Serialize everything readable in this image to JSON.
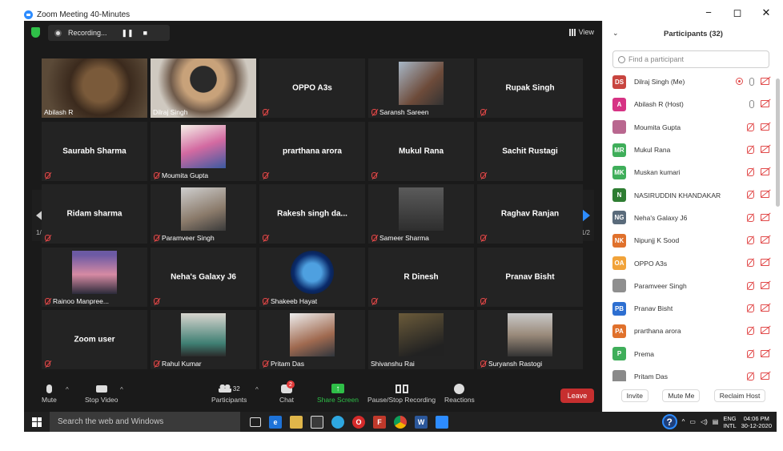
{
  "window": {
    "title": "Zoom Meeting 40-Minutes",
    "controls": [
      "−",
      "◻",
      "✕"
    ]
  },
  "recording": {
    "label": "Recording..."
  },
  "view": {
    "label": "View"
  },
  "gallery": {
    "page_indicator": "1/2",
    "tiles": [
      {
        "name": "Abilash R",
        "kind": "video",
        "active": true,
        "muted": false
      },
      {
        "name": "Dilraj Singh",
        "kind": "video",
        "active": false,
        "muted": false
      },
      {
        "name": "OPPO A3s",
        "kind": "name",
        "muted": true
      },
      {
        "name": "Saransh Sareen",
        "kind": "photo",
        "muted": true
      },
      {
        "name": "Rupak Singh",
        "kind": "name",
        "muted": true
      },
      {
        "name": "Saurabh Sharma",
        "kind": "name",
        "muted": true
      },
      {
        "name": "Moumita Gupta",
        "kind": "photo",
        "muted": true
      },
      {
        "name": "prarthana arora",
        "kind": "name",
        "muted": true
      },
      {
        "name": "Mukul Rana",
        "kind": "name",
        "muted": true
      },
      {
        "name": "Sachit Rustagi",
        "kind": "name",
        "muted": true
      },
      {
        "name": "Ridam sharma",
        "kind": "name",
        "muted": true
      },
      {
        "name": "Paramveer Singh",
        "kind": "photo",
        "muted": true
      },
      {
        "name": "Rakesh singh da...",
        "kind": "name",
        "muted": true
      },
      {
        "name": "Sameer Sharma",
        "kind": "photo",
        "muted": true
      },
      {
        "name": "Raghav Ranjan",
        "kind": "name",
        "muted": true
      },
      {
        "name": "Rainoo Manpree...",
        "kind": "photo",
        "muted": true
      },
      {
        "name": "Neha's Galaxy J6",
        "kind": "name",
        "muted": true
      },
      {
        "name": "Shakeeb Hayat",
        "kind": "photo",
        "muted": true
      },
      {
        "name": "R Dinesh",
        "kind": "name",
        "muted": true
      },
      {
        "name": "Pranav Bisht",
        "kind": "name",
        "muted": true
      },
      {
        "name": "Zoom user",
        "kind": "name",
        "muted": true
      },
      {
        "name": "Rahul Kumar",
        "kind": "photo",
        "muted": true
      },
      {
        "name": "Pritam Das",
        "kind": "photo",
        "muted": true
      },
      {
        "name": "Shivanshu Rai",
        "kind": "photo",
        "muted": false
      },
      {
        "name": "Suryansh Rastogi",
        "kind": "photo",
        "muted": true
      }
    ]
  },
  "toolbar": {
    "mute": "Mute",
    "stop_video": "Stop Video",
    "participants": "Participants",
    "participants_count": "32",
    "chat": "Chat",
    "chat_badge": "2",
    "share_screen": "Share Screen",
    "pause_stop_recording": "Pause/Stop Recording",
    "reactions": "Reactions",
    "leave": "Leave"
  },
  "panel": {
    "title": "Participants (32)",
    "search_placeholder": "Find a participant",
    "participants": [
      {
        "initials": "DS",
        "name": "Dilraj Singh (Me)",
        "color": "#c8453f",
        "state": "me"
      },
      {
        "initials": "A",
        "name": "Abilash R (Host)",
        "color": "#d63384",
        "state": "host"
      },
      {
        "initials": "",
        "name": "Moumita Gupta",
        "color": "#b9678f",
        "state": "muted"
      },
      {
        "initials": "MR",
        "name": "Mukul Rana",
        "color": "#3fae5a",
        "state": "muted"
      },
      {
        "initials": "MK",
        "name": "Muskan kumari",
        "color": "#3fae5a",
        "state": "muted"
      },
      {
        "initials": "N",
        "name": "NASIRUDDIN KHANDAKAR",
        "color": "#2e7d32",
        "state": "muted"
      },
      {
        "initials": "NG",
        "name": "Neha's Galaxy J6",
        "color": "#5a6b7b",
        "state": "muted"
      },
      {
        "initials": "NK",
        "name": "Nipunjj K Sood",
        "color": "#e0712c",
        "state": "muted"
      },
      {
        "initials": "OA",
        "name": "OPPO A3s",
        "color": "#f1a33a",
        "state": "muted"
      },
      {
        "initials": "",
        "name": "Paramveer Singh",
        "color": "#8f8f8f",
        "state": "muted"
      },
      {
        "initials": "PB",
        "name": "Pranav Bisht",
        "color": "#2d6fd1",
        "state": "muted"
      },
      {
        "initials": "PA",
        "name": "prarthana arora",
        "color": "#e0712c",
        "state": "muted"
      },
      {
        "initials": "P",
        "name": "Prema",
        "color": "#3fae5a",
        "state": "muted"
      },
      {
        "initials": "",
        "name": "Pritam Das",
        "color": "#8a8a8a",
        "state": "muted"
      }
    ],
    "invite": "Invite",
    "mute_me": "Mute Me",
    "reclaim_host": "Reclaim Host"
  },
  "taskbar": {
    "search_placeholder": "Search the web and Windows",
    "lang_top": "ENG",
    "lang_bottom": "INTL",
    "time": "04:06 PM",
    "date": "30-12-2020"
  }
}
